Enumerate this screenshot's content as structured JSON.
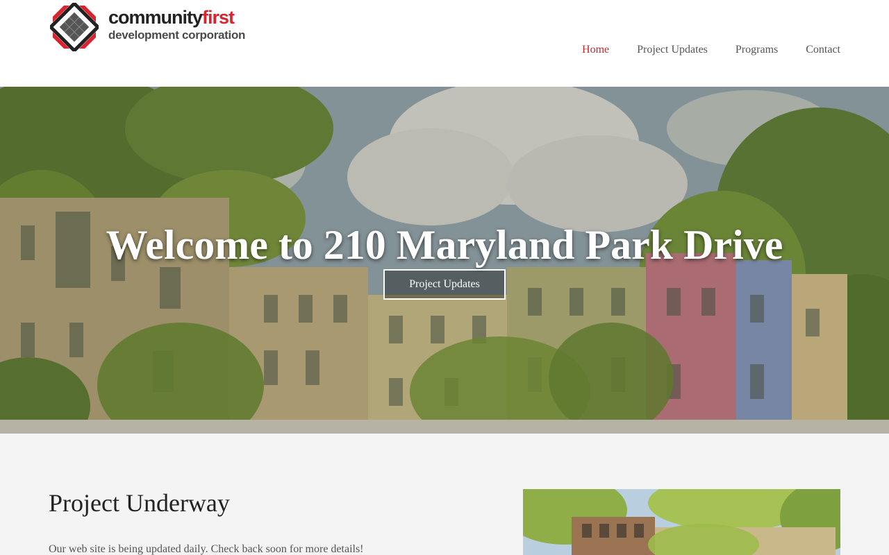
{
  "logo": {
    "line1_main": "community",
    "line1_accent": "first",
    "line2": "development corporation"
  },
  "nav": {
    "items": [
      {
        "label": "Home",
        "active": true
      },
      {
        "label": "Project Updates",
        "active": false
      },
      {
        "label": "Programs",
        "active": false
      },
      {
        "label": "Contact",
        "active": false
      }
    ]
  },
  "hero": {
    "title": "Welcome to 210 Maryland Park Drive",
    "button_label": "Project Updates"
  },
  "section": {
    "title": "Project Underway",
    "text": "Our web site is being updated daily. Check back soon for more details!"
  },
  "colors": {
    "accent": "#c0282d",
    "brand_red": "#d9232e",
    "content_bg": "#f4f4f4"
  }
}
